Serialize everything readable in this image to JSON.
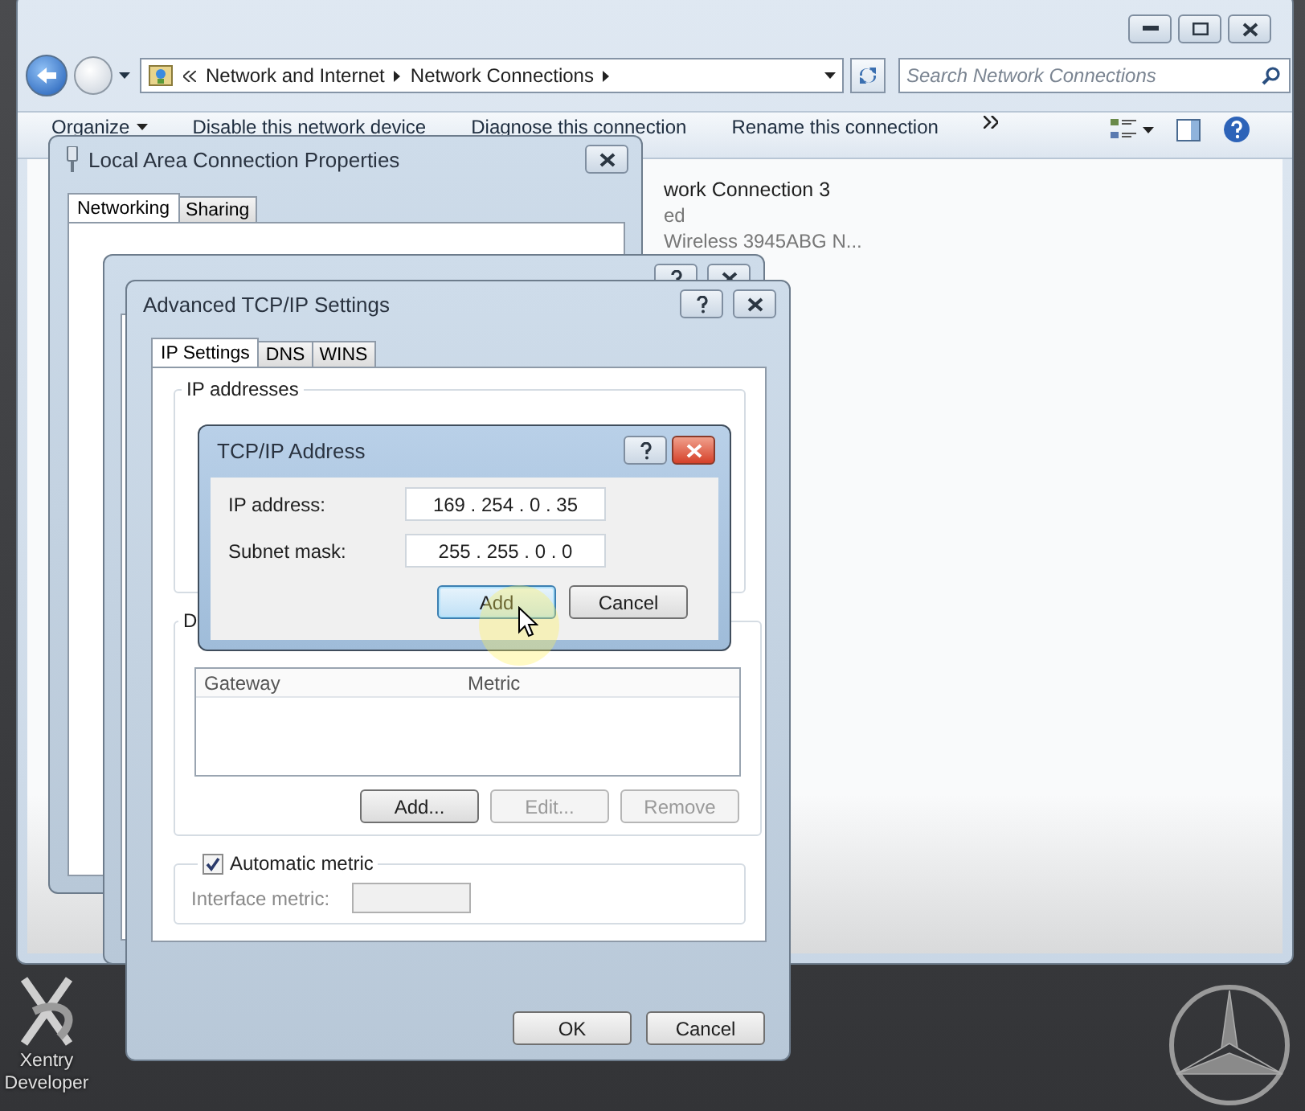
{
  "explorer": {
    "breadcrumb": [
      "Network and Internet",
      "Network Connections"
    ],
    "search": {
      "placeholder": "Search Network Connections"
    },
    "toolbar": [
      {
        "label": "Organize",
        "kind": "menu"
      },
      {
        "label": "Disable this network device",
        "kind": "command"
      },
      {
        "label": "Diagnose this connection",
        "kind": "command"
      },
      {
        "label": "Rename this connection",
        "kind": "command"
      }
    ],
    "connection": {
      "name": "work Connection 3",
      "status": "ed",
      "device": "Wireless 3945ABG N..."
    }
  },
  "lac_dialog": {
    "title": "Local Area Connection Properties",
    "tabs": [
      {
        "label": "Networking",
        "selected": true
      },
      {
        "label": "Sharing",
        "selected": false
      }
    ]
  },
  "advanced_dialog": {
    "title": "Advanced TCP/IP Settings",
    "tabs": [
      {
        "label": "IP Settings",
        "selected": true
      },
      {
        "label": "DNS",
        "selected": false
      },
      {
        "label": "WINS",
        "selected": false
      }
    ],
    "ip_group": {
      "label": "IP addresses"
    },
    "gateway_group": {
      "label": "D",
      "columns": [
        "Gateway",
        "Metric"
      ],
      "buttons": [
        {
          "label": "Add...",
          "disabled": false
        },
        {
          "label": "Edit...",
          "disabled": true
        },
        {
          "label": "Remove",
          "disabled": true
        }
      ]
    },
    "automatic_metric": {
      "label": "Automatic metric",
      "checked": true
    },
    "interface_metric": {
      "label": "Interface metric:",
      "disabled": true
    },
    "buttons": [
      "OK",
      "Cancel"
    ]
  },
  "address_dialog": {
    "title": "TCP/IP Address",
    "fields": [
      {
        "label": "IP address:",
        "value": "169 . 254 . 0 . 35"
      },
      {
        "label": "Subnet mask:",
        "value": "255 . 255 . 0 . 0"
      }
    ],
    "buttons": [
      {
        "label": "Add",
        "default": true
      },
      {
        "label": "Cancel",
        "default": false
      }
    ]
  },
  "desktop_icons": [
    {
      "label": "Xentry Developer"
    }
  ]
}
